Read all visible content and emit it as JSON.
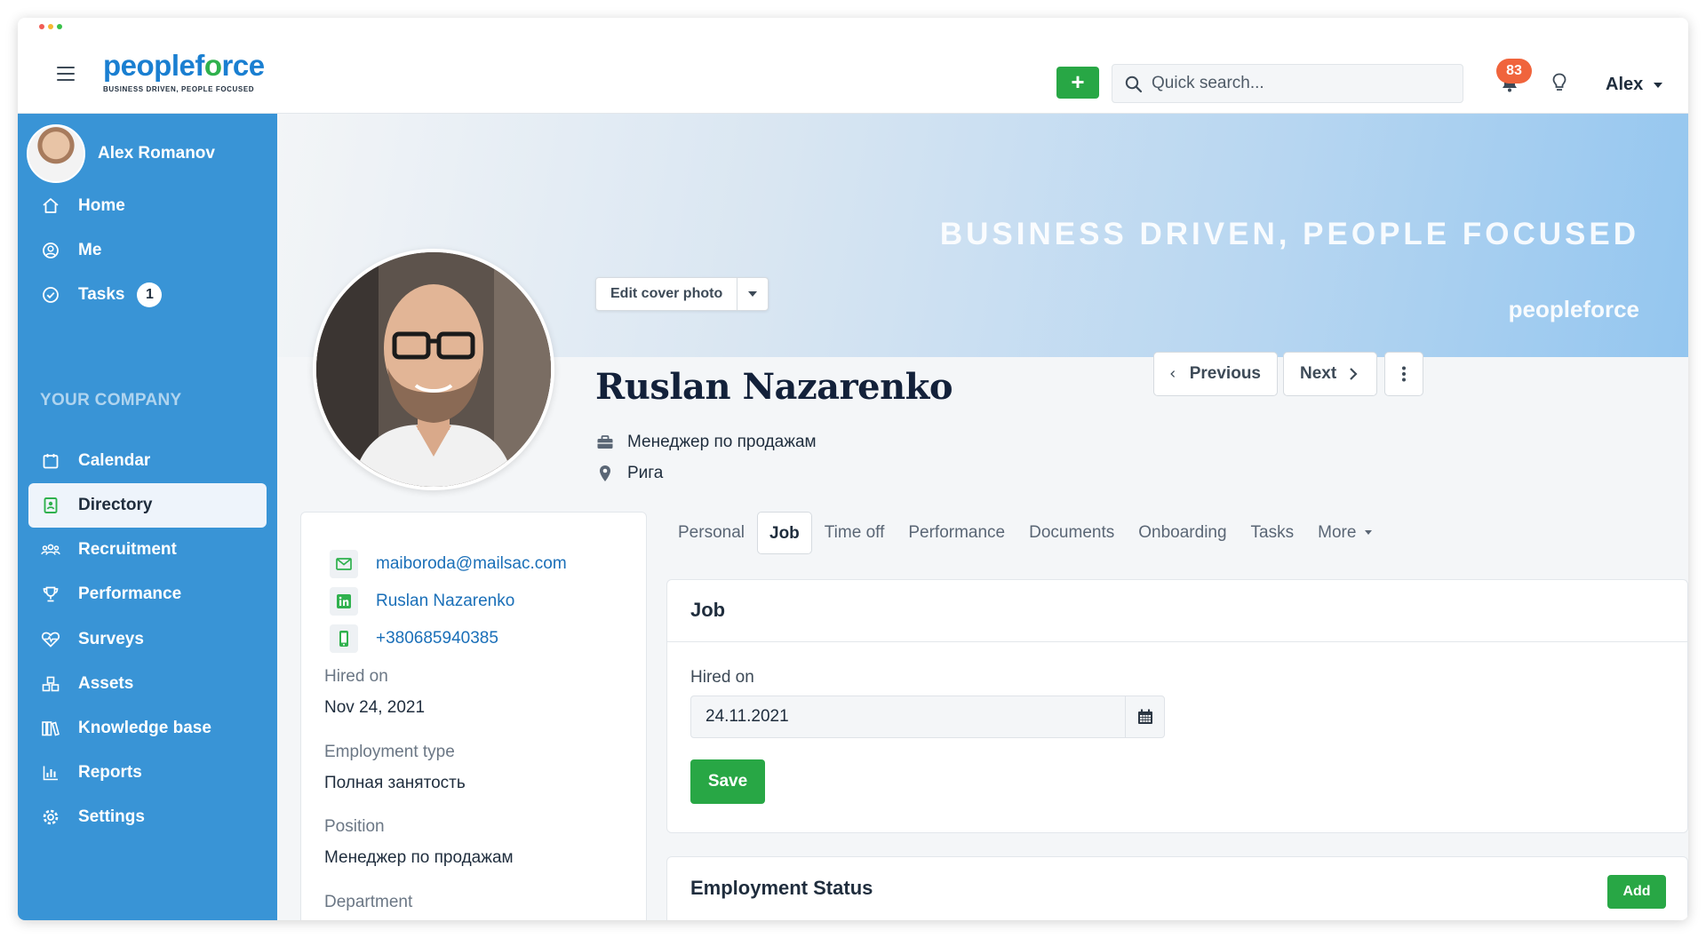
{
  "app": {
    "brand": "peopleforce",
    "brand_start": "peoplef",
    "brand_o": "o",
    "brand_end": "rce",
    "tagline": "BUSINESS DRIVEN, PEOPLE FOCUSED"
  },
  "topbar": {
    "add_label": "+",
    "search_placeholder": "Quick search...",
    "notifications_count": "83",
    "user_name": "Alex"
  },
  "sidebar": {
    "user_name": "Alex Romanov",
    "items_top": [
      {
        "label": "Home",
        "icon": "home-icon"
      },
      {
        "label": "Me",
        "icon": "user-circle-icon"
      },
      {
        "label": "Tasks",
        "icon": "check-circle-icon",
        "count": "1"
      }
    ],
    "section_title": "YOUR COMPANY",
    "items_company": [
      {
        "label": "Calendar",
        "icon": "calendar-icon"
      },
      {
        "label": "Directory",
        "icon": "address-book-icon",
        "active": true
      },
      {
        "label": "Recruitment",
        "icon": "people-group-icon"
      },
      {
        "label": "Performance",
        "icon": "trophy-icon"
      },
      {
        "label": "Surveys",
        "icon": "heartbeat-icon"
      },
      {
        "label": "Assets",
        "icon": "boxes-icon"
      },
      {
        "label": "Knowledge base",
        "icon": "books-icon"
      },
      {
        "label": "Reports",
        "icon": "bar-chart-icon"
      },
      {
        "label": "Settings",
        "icon": "gear-icon"
      }
    ]
  },
  "cover": {
    "slogan": "BUSINESS DRIVEN, PEOPLE FOCUSED",
    "logo_text": "peopleforce",
    "edit_label": "Edit cover photo"
  },
  "employee": {
    "name": "Ruslan Nazarenko",
    "position": "Менеджер по продажам",
    "location": "Рига",
    "prev_label": "Previous",
    "next_label": "Next"
  },
  "info": {
    "email": "maiboroda@mailsac.com",
    "linkedin": "Ruslan Nazarenko",
    "phone": "+380685940385",
    "fields": [
      {
        "label": "Hired on",
        "value": "Nov 24, 2021"
      },
      {
        "label": "Employment type",
        "value": "Полная занятость"
      },
      {
        "label": "Position",
        "value": "Менеджер по продажам"
      },
      {
        "label": "Department",
        "value": ""
      }
    ]
  },
  "tabs": [
    "Personal",
    "Job",
    "Time off",
    "Performance",
    "Documents",
    "Onboarding",
    "Tasks",
    "More"
  ],
  "active_tab": "Job",
  "job_card": {
    "title": "Job",
    "hired_label": "Hired on",
    "hired_value": "24.11.2021",
    "save_label": "Save"
  },
  "status_card": {
    "title": "Employment Status",
    "add_label": "Add"
  },
  "colors": {
    "sidebar": "#3994d6",
    "brand_blue": "#1a7fd1",
    "brand_green": "#2fb14d",
    "primary_button": "#28a745",
    "notification": "#f0643c"
  }
}
